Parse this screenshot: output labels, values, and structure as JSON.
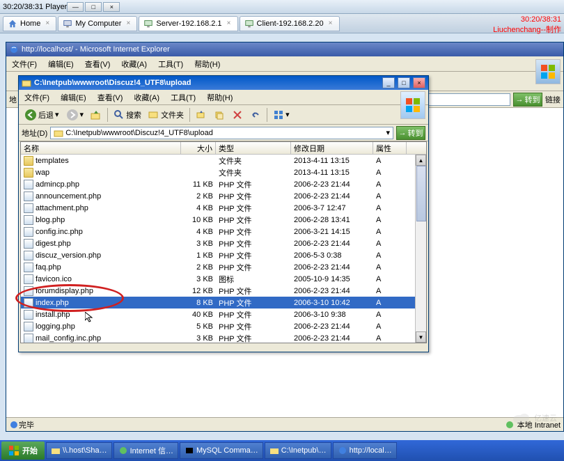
{
  "vm": {
    "title": "30:20/38:31 Player",
    "overlay_time": "30:20/38:31",
    "overlay_author": "Liuchenchang--制作"
  },
  "tabs": [
    {
      "icon": "home",
      "label": "Home"
    },
    {
      "icon": "computer",
      "label": "My Computer"
    },
    {
      "icon": "server",
      "label": "Server-192.168.2.1",
      "active": true
    },
    {
      "icon": "client",
      "label": "Client-192.168.2.20"
    }
  ],
  "ie": {
    "title": "http://localhost/ - Microsoft Internet Explorer",
    "menus": [
      "文件(F)",
      "编辑(E)",
      "查看(V)",
      "收藏(A)",
      "工具(T)",
      "帮助(H)"
    ],
    "address_label": "地",
    "go": "转到",
    "links": "链接",
    "status": "完毕",
    "status_right": "本地 Intranet",
    "http_local": "http://local…"
  },
  "explorer": {
    "title": "C:\\Inetpub\\wwwroot\\Discuz!4_UTF8\\upload",
    "menus": [
      "文件(F)",
      "编辑(E)",
      "查看(V)",
      "收藏(A)",
      "工具(T)",
      "帮助(H)"
    ],
    "back": "后退",
    "search": "搜索",
    "folders": "文件夹",
    "address_label": "地址(D)",
    "address_value": "C:\\Inetpub\\wwwroot\\Discuz!4_UTF8\\upload",
    "go": "转到",
    "columns": {
      "name": "名称",
      "size": "大小",
      "type": "类型",
      "date": "修改日期",
      "attr": "属性"
    },
    "files": [
      {
        "icon": "folder",
        "name": "templates",
        "size": "",
        "type": "文件夹",
        "date": "2013-4-11 13:15",
        "attr": "A"
      },
      {
        "icon": "folder",
        "name": "wap",
        "size": "",
        "type": "文件夹",
        "date": "2013-4-11 13:15",
        "attr": "A"
      },
      {
        "icon": "php",
        "name": "admincp.php",
        "size": "11 KB",
        "type": "PHP 文件",
        "date": "2006-2-23 21:44",
        "attr": "A"
      },
      {
        "icon": "php",
        "name": "announcement.php",
        "size": "2 KB",
        "type": "PHP 文件",
        "date": "2006-2-23 21:44",
        "attr": "A"
      },
      {
        "icon": "php",
        "name": "attachment.php",
        "size": "4 KB",
        "type": "PHP 文件",
        "date": "2006-3-7 12:47",
        "attr": "A"
      },
      {
        "icon": "php",
        "name": "blog.php",
        "size": "10 KB",
        "type": "PHP 文件",
        "date": "2006-2-28 13:41",
        "attr": "A"
      },
      {
        "icon": "php",
        "name": "config.inc.php",
        "size": "4 KB",
        "type": "PHP 文件",
        "date": "2006-3-21 14:15",
        "attr": "A"
      },
      {
        "icon": "php",
        "name": "digest.php",
        "size": "3 KB",
        "type": "PHP 文件",
        "date": "2006-2-23 21:44",
        "attr": "A"
      },
      {
        "icon": "php",
        "name": "discuz_version.php",
        "size": "1 KB",
        "type": "PHP 文件",
        "date": "2006-5-3 0:38",
        "attr": "A"
      },
      {
        "icon": "php",
        "name": "faq.php",
        "size": "2 KB",
        "type": "PHP 文件",
        "date": "2006-2-23 21:44",
        "attr": "A"
      },
      {
        "icon": "ico",
        "name": "favicon.ico",
        "size": "3 KB",
        "type": "图标",
        "date": "2005-10-9 14:35",
        "attr": "A"
      },
      {
        "icon": "php",
        "name": "forumdisplay.php",
        "size": "12 KB",
        "type": "PHP 文件",
        "date": "2006-2-23 21:44",
        "attr": "A"
      },
      {
        "icon": "php",
        "name": "index.php",
        "size": "8 KB",
        "type": "PHP 文件",
        "date": "2006-3-10 10:42",
        "attr": "A",
        "selected": true
      },
      {
        "icon": "php",
        "name": "install.php",
        "size": "40 KB",
        "type": "PHP 文件",
        "date": "2006-3-10 9:38",
        "attr": "A"
      },
      {
        "icon": "php",
        "name": "logging.php",
        "size": "5 KB",
        "type": "PHP 文件",
        "date": "2006-2-23 21:44",
        "attr": "A"
      },
      {
        "icon": "php",
        "name": "mail_config.inc.php",
        "size": "3 KB",
        "type": "PHP 文件",
        "date": "2006-2-23 21:44",
        "attr": "A"
      }
    ]
  },
  "taskbar": {
    "start": "开始",
    "items": [
      "\\\\.host\\Sha…",
      "Internet 信…",
      "MySQL Comma…",
      "C:\\Inetpub\\…",
      "http://local…"
    ]
  },
  "watermark": "亿速云"
}
